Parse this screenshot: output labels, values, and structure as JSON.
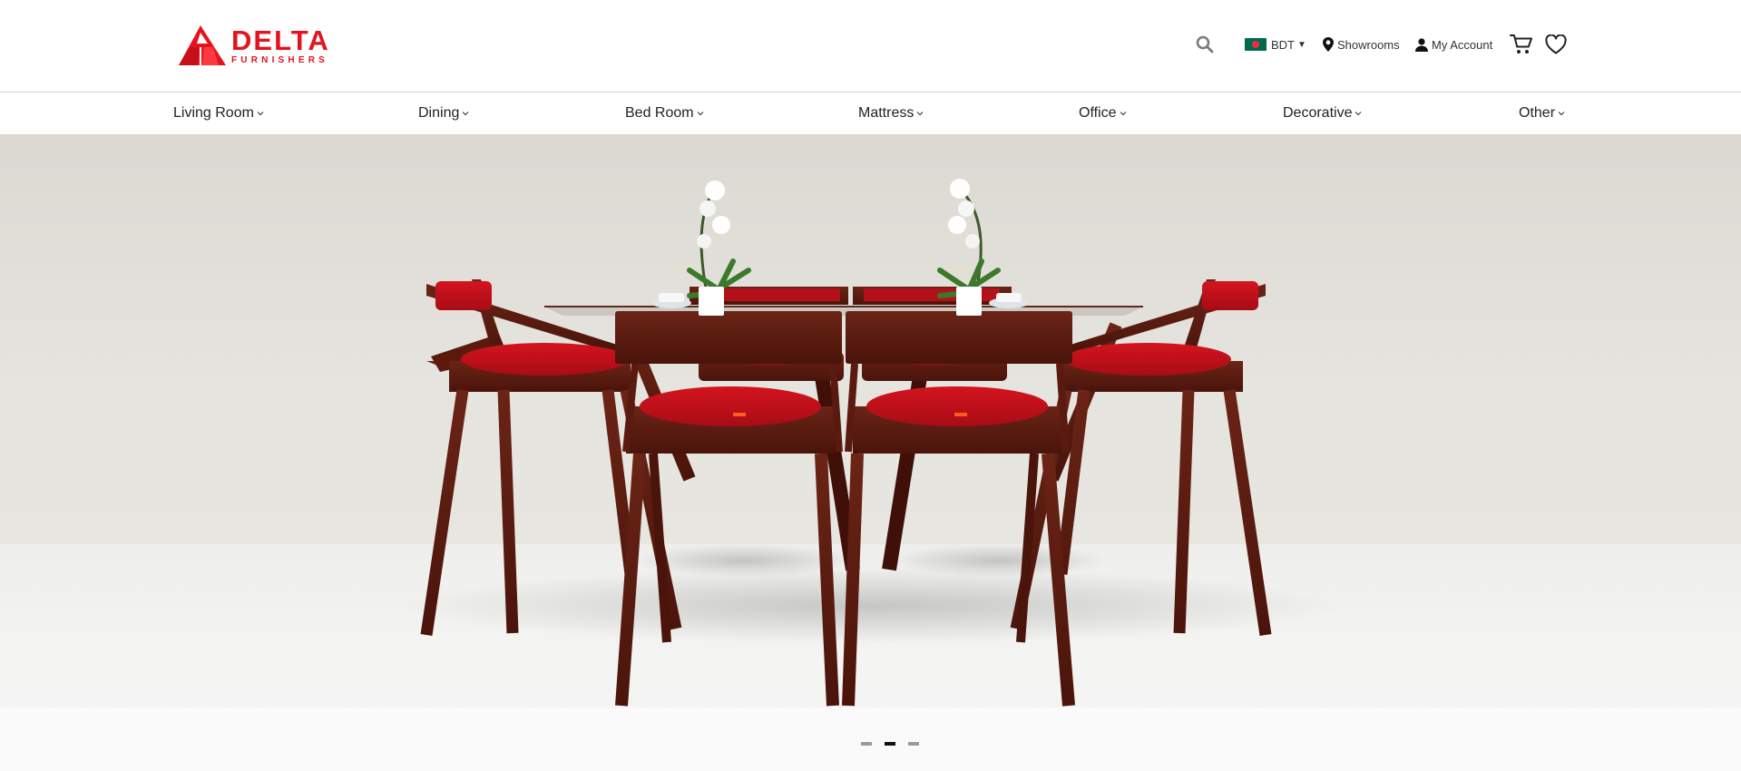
{
  "brand": {
    "logo_alt": "Delta Furnishers",
    "name_line1": "DELTA",
    "name_line2": "FURNISHERS",
    "color": "#e3141d"
  },
  "header": {
    "search_icon": "search-icon",
    "currency": {
      "flag": "bangladesh-flag-icon",
      "code": "BDT"
    },
    "showrooms": "Showrooms",
    "account": "My Account",
    "cart_icon": "cart-icon",
    "wishlist_icon": "heart-icon"
  },
  "nav": {
    "items": [
      {
        "label": "Living Room"
      },
      {
        "label": "Dining"
      },
      {
        "label": "Bed Room"
      },
      {
        "label": "Mattress"
      },
      {
        "label": "Office"
      },
      {
        "label": "Decorative"
      },
      {
        "label": "Other"
      }
    ]
  },
  "hero": {
    "image_subject": "dining-set-with-red-upholstered-chairs",
    "slides_total": 3,
    "active_slide": 2
  },
  "colors": {
    "accent": "#e3141d",
    "wood": "#5a1a10",
    "upholstery": "#c2101c"
  }
}
